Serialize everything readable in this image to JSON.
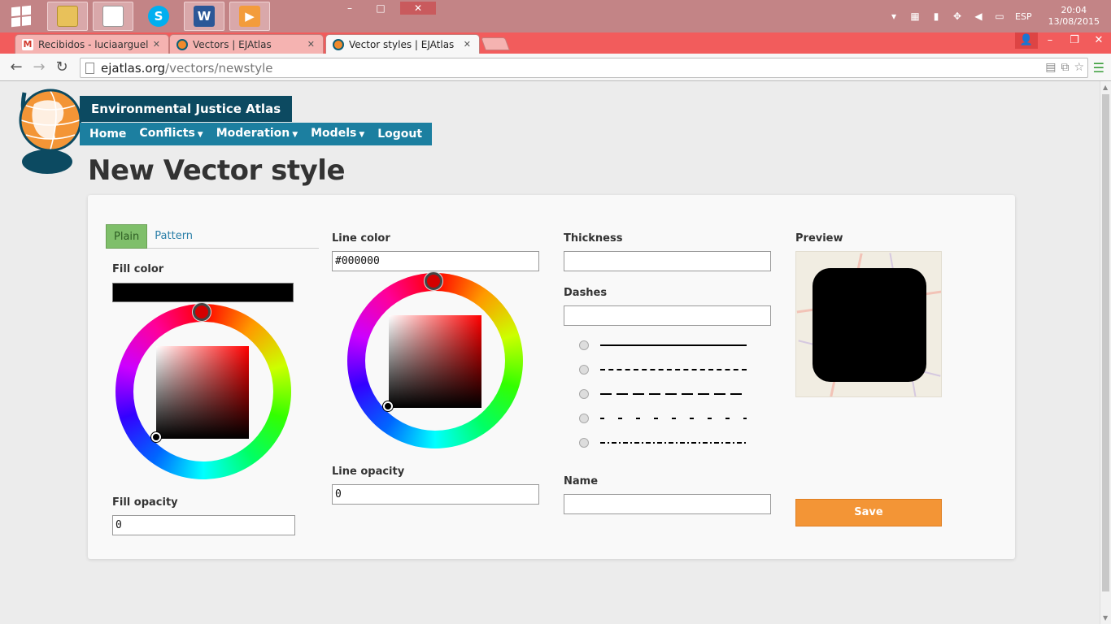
{
  "taskbar": {
    "apps": [
      {
        "name": "file-explorer",
        "glyph": ""
      },
      {
        "name": "document",
        "glyph": ""
      },
      {
        "name": "skype",
        "glyph": "S"
      },
      {
        "name": "word",
        "glyph": "W"
      },
      {
        "name": "media-player",
        "glyph": "▶"
      }
    ],
    "language": "ESP",
    "time": "20:04",
    "date": "13/08/2015"
  },
  "browser": {
    "tabs": [
      {
        "title": "Recibidos - luciaarguelles",
        "favicon": "gmail-icon",
        "active": false
      },
      {
        "title": "Vectors | EJAtlas",
        "favicon": "globe-icon",
        "active": false
      },
      {
        "title": "Vector styles | EJAtlas",
        "favicon": "globe-icon",
        "active": true
      }
    ],
    "url_host": "ejatlas.org",
    "url_path": "/vectors/newstyle"
  },
  "site": {
    "title": "Environmental Justice Atlas",
    "nav": [
      {
        "label": "Home",
        "dropdown": false
      },
      {
        "label": "Conflicts",
        "dropdown": true
      },
      {
        "label": "Moderation",
        "dropdown": true
      },
      {
        "label": "Models",
        "dropdown": true
      },
      {
        "label": "Logout",
        "dropdown": false
      }
    ]
  },
  "page_title": "New Vector style",
  "form": {
    "tabs": [
      {
        "label": "Plain",
        "active": true
      },
      {
        "label": "Pattern",
        "active": false
      }
    ],
    "fill_color_label": "Fill color",
    "fill_color_value": "#000000",
    "fill_opacity_label": "Fill opacity",
    "fill_opacity_value": "0",
    "line_color_label": "Line color",
    "line_color_value": "#000000",
    "line_opacity_label": "Line opacity",
    "line_opacity_value": "0",
    "thickness_label": "Thickness",
    "thickness_value": "",
    "dashes_label": "Dashes",
    "dashes_value": "",
    "dash_options": [
      "solid",
      "dashed-short",
      "dashed-long",
      "dotted-sparse",
      "dash-dot"
    ],
    "name_label": "Name",
    "name_value": "",
    "preview_label": "Preview",
    "save_label": "Save"
  },
  "colors": {
    "site_title_bg": "#0c4a61",
    "site_nav_bg": "#1c7fa0",
    "tab_active_bg": "#7fbf6a",
    "save_bg": "#f39536",
    "taskbar_bg": "#c38486",
    "tabstrip_bg": "#f25c5c"
  }
}
